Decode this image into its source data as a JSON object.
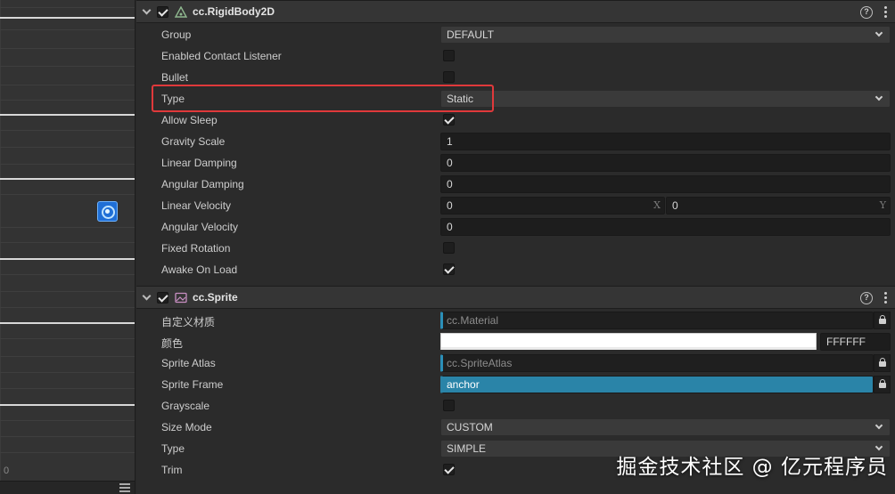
{
  "scene": {
    "zero_label": "0",
    "menu_icon": "hamburger-icon"
  },
  "rigidbody": {
    "title": "cc.RigidBody2D",
    "enabled": true,
    "icon": "rigidbody-triangle-icon",
    "props": {
      "group": {
        "label": "Group",
        "value": "DEFAULT"
      },
      "enabled_contact_listener": {
        "label": "Enabled Contact Listener",
        "checked": false
      },
      "bullet": {
        "label": "Bullet",
        "checked": false
      },
      "type": {
        "label": "Type",
        "value": "Static"
      },
      "allow_sleep": {
        "label": "Allow Sleep",
        "checked": true
      },
      "gravity_scale": {
        "label": "Gravity Scale",
        "value": "1"
      },
      "linear_damping": {
        "label": "Linear Damping",
        "value": "0"
      },
      "angular_damping": {
        "label": "Angular Damping",
        "value": "0"
      },
      "linear_velocity": {
        "label": "Linear Velocity",
        "x": "0",
        "y": "0",
        "x_axis": "X",
        "y_axis": "Y"
      },
      "angular_velocity": {
        "label": "Angular Velocity",
        "value": "0"
      },
      "fixed_rotation": {
        "label": "Fixed Rotation",
        "checked": false
      },
      "awake_on_load": {
        "label": "Awake On Load",
        "checked": true
      }
    }
  },
  "sprite": {
    "title": "cc.Sprite",
    "enabled": true,
    "icon": "sprite-image-icon",
    "props": {
      "custom_material": {
        "label": "自定义材质",
        "placeholder": "cc.Material"
      },
      "color": {
        "label": "颜色",
        "hex": "FFFFFF",
        "swatch": "#ffffff"
      },
      "sprite_atlas": {
        "label": "Sprite Atlas",
        "placeholder": "cc.SpriteAtlas"
      },
      "sprite_frame": {
        "label": "Sprite Frame",
        "value": "anchor"
      },
      "grayscale": {
        "label": "Grayscale",
        "checked": false
      },
      "size_mode": {
        "label": "Size Mode",
        "value": "CUSTOM"
      },
      "type": {
        "label": "Type",
        "value": "SIMPLE"
      },
      "trim": {
        "label": "Trim",
        "checked": true
      }
    }
  },
  "highlight_color": "#e0393b",
  "accent_color": "#2a84a8",
  "watermark": "掘金技术社区 @ 亿元程序员"
}
